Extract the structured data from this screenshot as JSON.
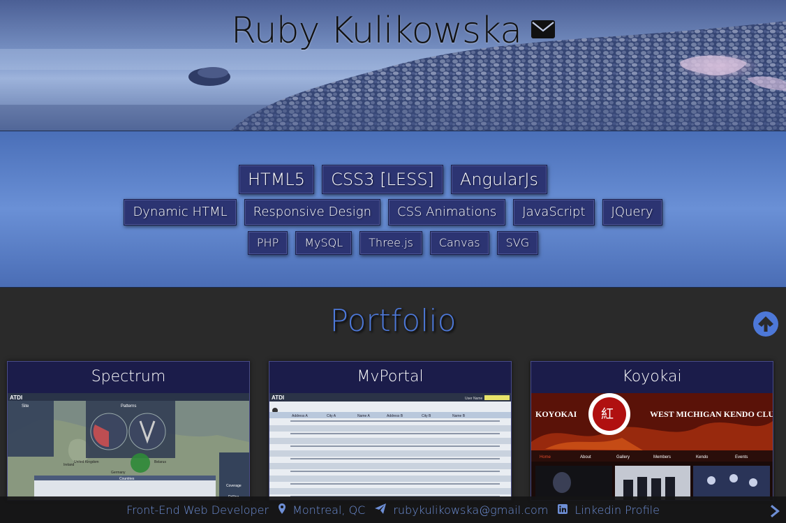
{
  "header": {
    "name": "Ruby Kulikowska",
    "contact_icon": "envelope-icon"
  },
  "skills": {
    "row1": [
      "HTML5",
      "CSS3 [LESS]",
      "AngularJs"
    ],
    "row2": [
      "Dynamic HTML",
      "Responsive Design",
      "CSS Animations",
      "JavaScript",
      "JQuery"
    ],
    "row3": [
      "PHP",
      "MySQL",
      "Three.js",
      "Canvas",
      "SVG"
    ]
  },
  "portfolio": {
    "heading": "Portfolio",
    "scroll_up_icon": "arrow-circle-up-icon",
    "projects": [
      {
        "title": "Spectrum",
        "screenshot_texts": [
          "ATDI",
          "Site",
          "Patterns",
          "Countries",
          "Coverage",
          "Drilling",
          "United Kingdom",
          "Ireland",
          "Germany",
          "Belarus"
        ]
      },
      {
        "title": "MvPortal",
        "screenshot_texts": [
          "ATDI",
          "User Name",
          "Address A",
          "City A",
          "Name A",
          "Address B",
          "City B",
          "Name B"
        ]
      },
      {
        "title": "Koyokai",
        "screenshot_texts": [
          "KOYOKAI",
          "WEST MICHIGAN KENDO CLUB",
          "Home",
          "About",
          "Gallery",
          "Members",
          "Kendo",
          "Events"
        ]
      }
    ]
  },
  "footer": {
    "role": "Front-End Web Developer",
    "location_icon": "map-marker-icon",
    "location": "Montreal, QC",
    "email_icon": "paper-plane-icon",
    "email": "rubykulikowska@gmail.com",
    "linkedin_icon": "linkedin-icon",
    "linkedin": "Linkedin Profile",
    "next_icon": "chevron-right-icon"
  },
  "colors": {
    "skill_bg": "#2c3472",
    "skills_band": "#6a90d6",
    "portfolio_heading": "#4d78d8",
    "card_bg": "#1b1c4a",
    "footer_text": "#6e8fd6"
  }
}
